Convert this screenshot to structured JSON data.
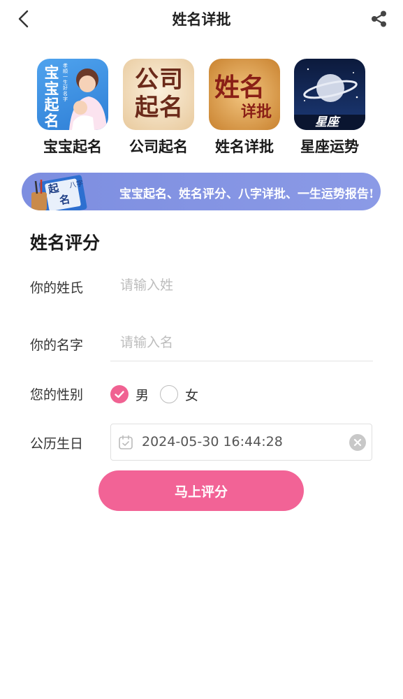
{
  "header": {
    "title": "姓名详批",
    "back_icon": "chevron-left-icon",
    "share_icon": "share-icon"
  },
  "apps": [
    {
      "label": "宝宝起名",
      "icon": "baby-naming-icon",
      "icon_text": "宝宝起名",
      "icon_subtext": "孝順一生好名字",
      "color": "#3d8fe0"
    },
    {
      "label": "公司起名",
      "icon": "company-naming-icon",
      "icon_text": "公司起名",
      "color": "#f1d9b8"
    },
    {
      "label": "姓名详批",
      "icon": "name-analysis-icon",
      "icon_text": "姓名",
      "icon_subtext": "详批",
      "color": "#d99a4a"
    },
    {
      "label": "星座运势",
      "icon": "constellation-icon",
      "icon_text": "星座",
      "color": "#10224a"
    }
  ],
  "banner": {
    "text": "宝宝起名、姓名评分、八字详批、一生运势报告!",
    "book_text_1": "起",
    "book_text_2": "名",
    "book_text_3": "八字",
    "color": "#8796e3"
  },
  "form": {
    "section_title": "姓名评分",
    "surname": {
      "label": "你的姓氏",
      "placeholder": "请输入姓",
      "value": ""
    },
    "given_name": {
      "label": "你的名字",
      "placeholder": "请输入名",
      "value": ""
    },
    "gender": {
      "label": "您的性别",
      "options": [
        {
          "label": "男",
          "selected": true
        },
        {
          "label": "女",
          "selected": false
        }
      ]
    },
    "birthday": {
      "label": "公历生日",
      "value": "2024-05-30 16:44:28",
      "icon": "calendar-icon",
      "clear_icon": "clear-icon"
    },
    "submit_label": "马上评分"
  },
  "colors": {
    "accent_pink": "#f26396",
    "banner_blue": "#8796e3"
  }
}
